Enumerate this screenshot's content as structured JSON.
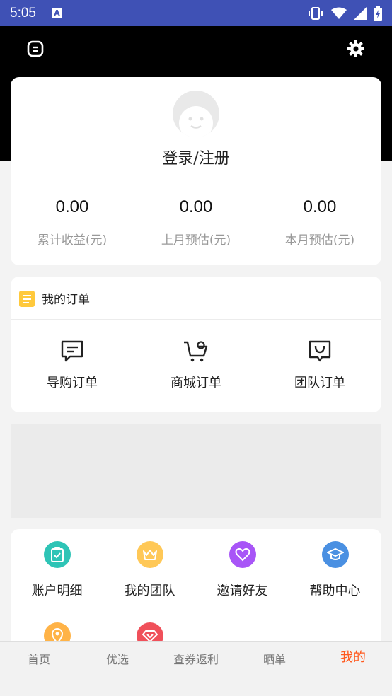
{
  "status": {
    "time": "5:05",
    "a_label": "A"
  },
  "profile": {
    "login": "登录/注册"
  },
  "stats": [
    {
      "value": "0.00",
      "label": "累计收益(元)"
    },
    {
      "value": "0.00",
      "label": "上月预估(元)"
    },
    {
      "value": "0.00",
      "label": "本月预估(元)"
    }
  ],
  "orders": {
    "title": "我的订单",
    "items": [
      {
        "label": "导购订单",
        "icon": "chat-list-icon"
      },
      {
        "label": "商城订单",
        "icon": "cart-icon"
      },
      {
        "label": "团队订单",
        "icon": "bag-icon"
      }
    ]
  },
  "tools": [
    {
      "label": "账户明细",
      "icon": "clipboard-icon",
      "color": "#2ec4b6"
    },
    {
      "label": "我的团队",
      "icon": "crown-icon",
      "color": "#ffc857"
    },
    {
      "label": "邀请好友",
      "icon": "heart-icon",
      "color": "#a855f7"
    },
    {
      "label": "帮助中心",
      "icon": "graduation-icon",
      "color": "#4a90e2"
    },
    {
      "label": "",
      "icon": "location-icon",
      "color": "#ffb347"
    },
    {
      "label": "",
      "icon": "diamond-icon",
      "color": "#f0505a"
    }
  ],
  "tabs": [
    {
      "label": "首页"
    },
    {
      "label": "优选"
    },
    {
      "label": "查券返利"
    },
    {
      "label": "晒单"
    },
    {
      "label": "我的",
      "active": true
    }
  ],
  "colors": {
    "status_bar": "#3f51b5",
    "active_tab": "#ff5a1f"
  }
}
